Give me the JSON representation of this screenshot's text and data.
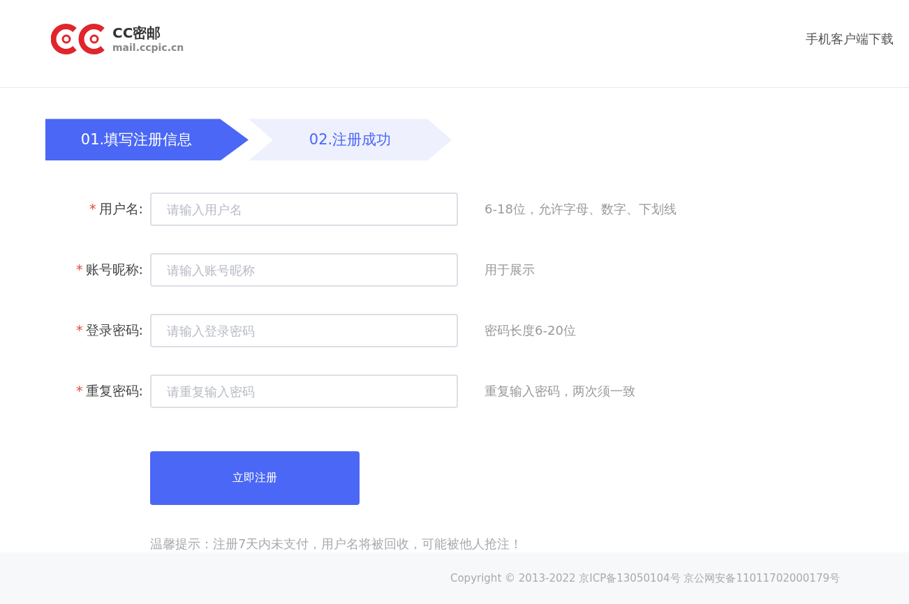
{
  "header": {
    "logo_title": "CC密邮",
    "logo_subtitle": "mail.ccpic.cn",
    "download_link": "手机客户端下载"
  },
  "steps": [
    {
      "label": "01.填写注册信息",
      "selected": true
    },
    {
      "label": "02.注册成功",
      "selected": false
    }
  ],
  "form": {
    "fields": [
      {
        "required_mark": "*",
        "label": "用户名:",
        "placeholder": "请输入用户名",
        "hint": "6-18位，允许字母、数字、下划线"
      },
      {
        "required_mark": "*",
        "label": "账号昵称:",
        "placeholder": "请输入账号昵称",
        "hint": "用于展示"
      },
      {
        "required_mark": "*",
        "label": "登录密码:",
        "placeholder": "请输入登录密码",
        "hint": "密码长度6-20位"
      },
      {
        "required_mark": "*",
        "label": "重复密码:",
        "placeholder": "请重复输入密码",
        "hint": "重复输入密码，两次须一致"
      }
    ],
    "submit": "立即注册",
    "notice": "温馨提示：注册7天内未支付，用户名将被回收，可能被他人抢注！"
  },
  "footer": {
    "copyright": "Copyright © 2013-2022 京ICP备13050104号 京公网安备11011702000179号"
  }
}
